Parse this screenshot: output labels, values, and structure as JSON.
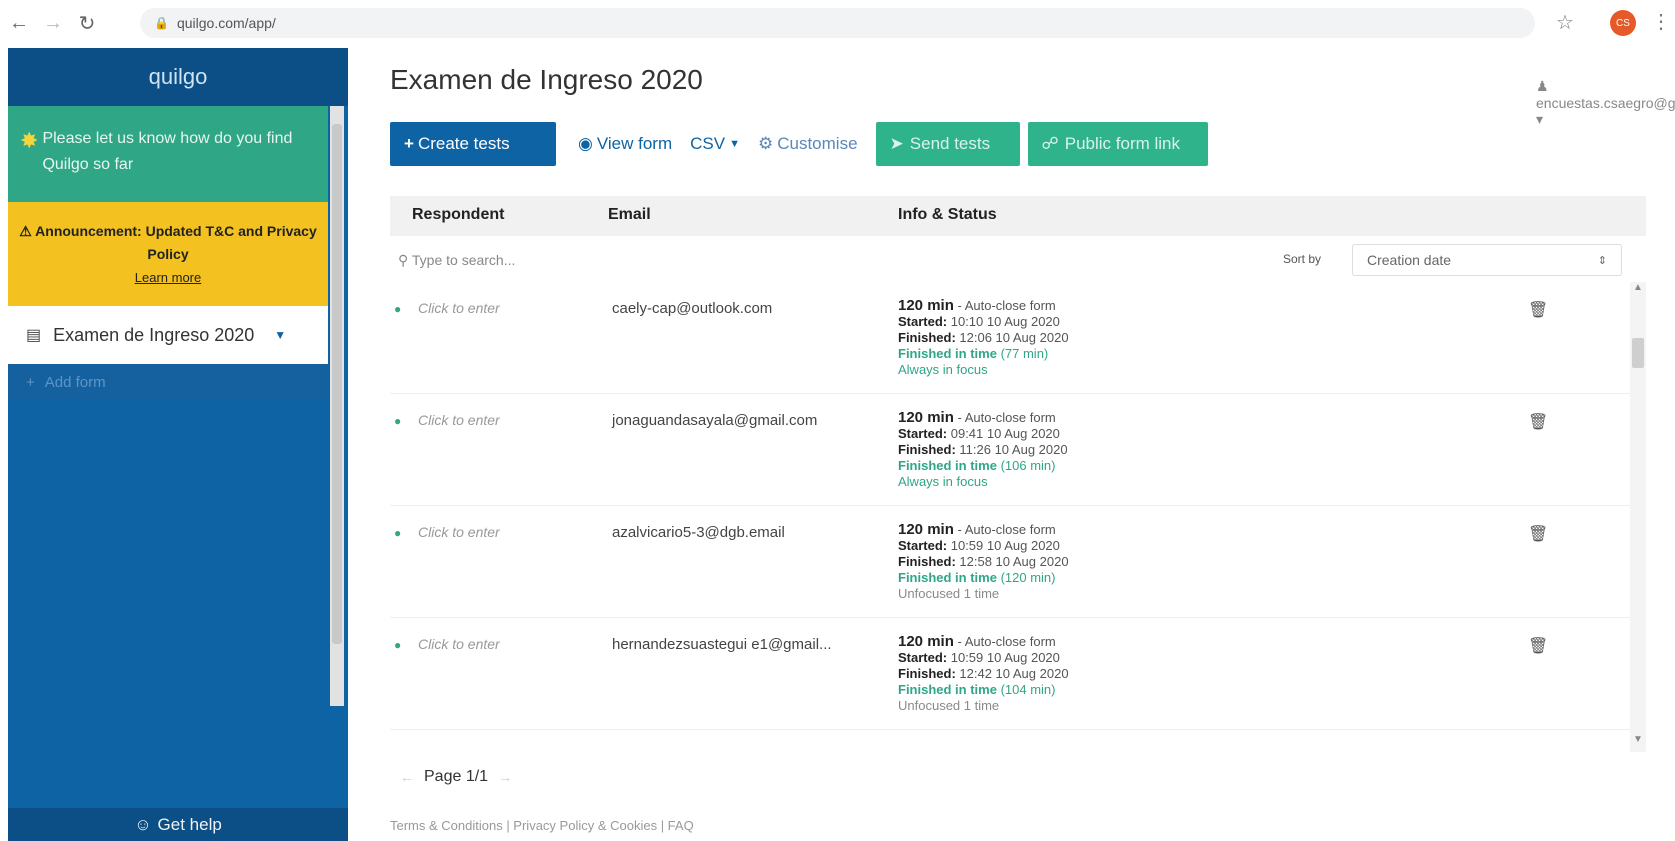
{
  "browser": {
    "url": "quilgo.com/app/",
    "profile_initials": "CS"
  },
  "sidebar": {
    "brand": "quilgo",
    "feedback": "Please let us know how do you find Quilgo so far",
    "announcement": {
      "title": "Announcement: Updated T&C and Privacy Policy",
      "link": "Learn more"
    },
    "form_item": "Examen de Ingreso 2020",
    "add_form": "Add form",
    "get_help": "Get help"
  },
  "main": {
    "title": "Examen de Ingreso 2020",
    "user_email": "encuestas.csaegro@gmail.com",
    "toolbar": {
      "create_tests": "Create tests",
      "view_form": "View form",
      "csv": "CSV",
      "customise": "Customise",
      "send_tests": "Send tests",
      "public_form_link": "Public form link"
    },
    "table": {
      "headers": [
        "Respondent",
        "Email",
        "Info & Status"
      ],
      "search_placeholder": "Type to search...",
      "sort_label": "Sort by",
      "sort_value": "Creation date",
      "rows": [
        {
          "respondent": "Click to enter",
          "email": "caely-cap@outlook.com",
          "duration": "120 min",
          "mode": " - Auto-close form",
          "started": "10:10 10 Aug 2020",
          "finished": "12:06 10 Aug 2020",
          "fit_label": "Finished in time",
          "fit_value": " (77 min)",
          "focus": "Always in focus",
          "focus_ok": true
        },
        {
          "respondent": "Click to enter",
          "email": "jonaguandasayala@gmail.com",
          "duration": "120 min",
          "mode": " - Auto-close form",
          "started": "09:41 10 Aug 2020",
          "finished": "11:26 10 Aug 2020",
          "fit_label": "Finished in time",
          "fit_value": " (106 min)",
          "focus": "Always in focus",
          "focus_ok": true
        },
        {
          "respondent": "Click to enter",
          "email": "azalvicario5-3@dgb.email",
          "duration": "120 min",
          "mode": " - Auto-close form",
          "started": "10:59 10 Aug 2020",
          "finished": "12:58 10 Aug 2020",
          "fit_label": "Finished in time",
          "fit_value": " (120 min)",
          "focus": "Unfocused 1 time",
          "focus_ok": false
        },
        {
          "respondent": "Click to enter",
          "email": "hernandezsuastegui e1@gmail...",
          "duration": "120 min",
          "mode": " - Auto-close form",
          "started": "10:59 10 Aug 2020",
          "finished": "12:42 10 Aug 2020",
          "fit_label": "Finished in time",
          "fit_value": " (104 min)",
          "focus": "Unfocused 1 time",
          "focus_ok": false
        }
      ],
      "started_label": "Started: ",
      "finished_label": "Finished: "
    },
    "pager": "Page 1/1",
    "footer": "Terms & Conditions | Privacy Policy & Cookies | FAQ"
  }
}
